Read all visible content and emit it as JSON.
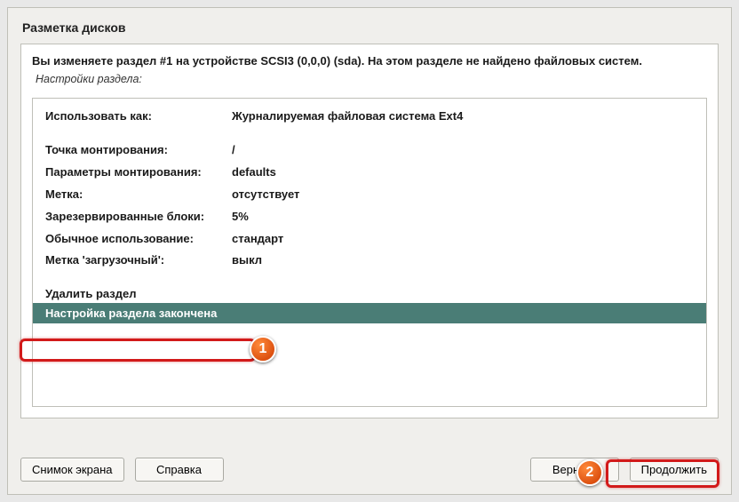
{
  "title": "Разметка дисков",
  "intro": "Вы изменяете раздел #1 на устройстве SCSI3 (0,0,0) (sda). На этом разделе не найдено файловых систем.",
  "settings_header": "Настройки раздела:",
  "rows": {
    "use_as_label": "Использовать как:",
    "use_as_value": "Журналируемая файловая система Ext4",
    "mount_point_label": "Точка монтирования:",
    "mount_point_value": "/",
    "mount_opts_label": "Параметры монтирования:",
    "mount_opts_value": "defaults",
    "label_label": "Метка:",
    "label_value": "отсутствует",
    "reserved_label": "Зарезервированные блоки:",
    "reserved_value": "5%",
    "usage_label": "Обычное использование:",
    "usage_value": "стандарт",
    "boot_label": "Метка 'загрузочный':",
    "boot_value": "выкл"
  },
  "actions": {
    "delete": "Удалить раздел",
    "done": "Настройка раздела закончена"
  },
  "buttons": {
    "screenshot": "Снимок экрана",
    "help": "Справка",
    "back": "Вернуть",
    "continue": "Продолжить"
  },
  "annotations": {
    "badge1": "1",
    "badge2": "2"
  }
}
